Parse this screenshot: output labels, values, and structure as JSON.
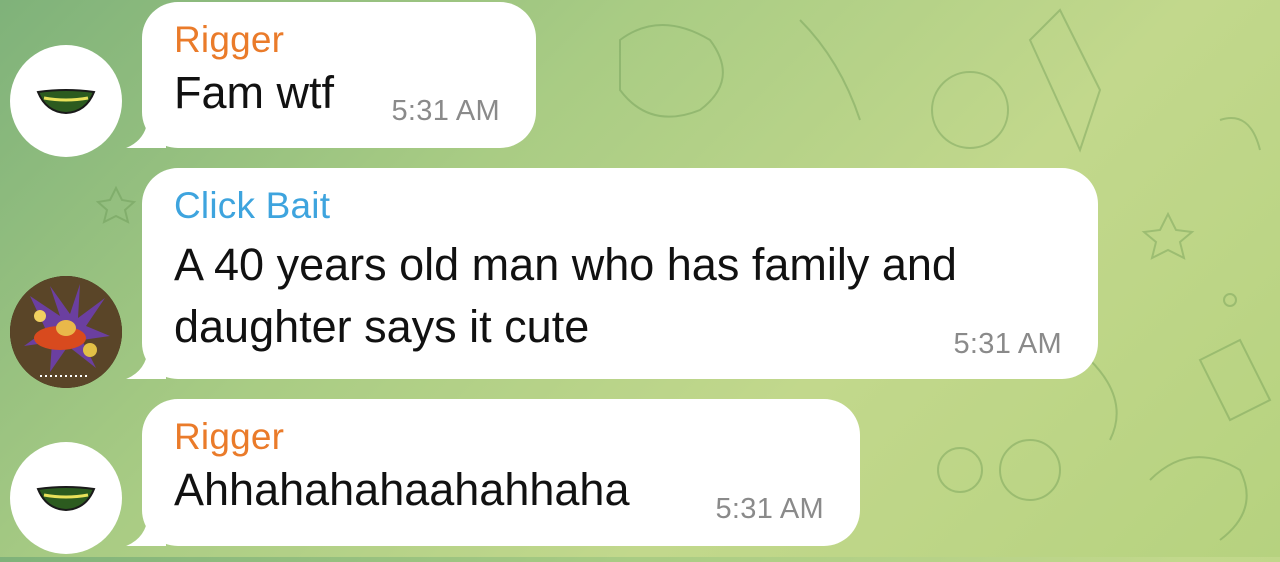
{
  "colors": {
    "rigger_name": "#ea7b2a",
    "clickbait_name": "#3ea4de",
    "bubble_bg": "#ffffff",
    "time_text": "#8a8a8a",
    "wallpaper": "#a9cc84"
  },
  "messages": [
    {
      "sender": "Rigger",
      "avatar_icon": "green-bowl-avatar-icon",
      "text": "Fam wtf",
      "time": "5:31 AM"
    },
    {
      "sender": "Click Bait",
      "avatar_icon": "anime-character-avatar",
      "text_line1": "A 40 years old man who has family and",
      "text_line2": "daughter says it cute",
      "time": "5:31 AM"
    },
    {
      "sender": "Rigger",
      "avatar_icon": "green-bowl-avatar-icon",
      "text": "Ahhahahahaahahhaha",
      "time": "5:31 AM"
    }
  ]
}
